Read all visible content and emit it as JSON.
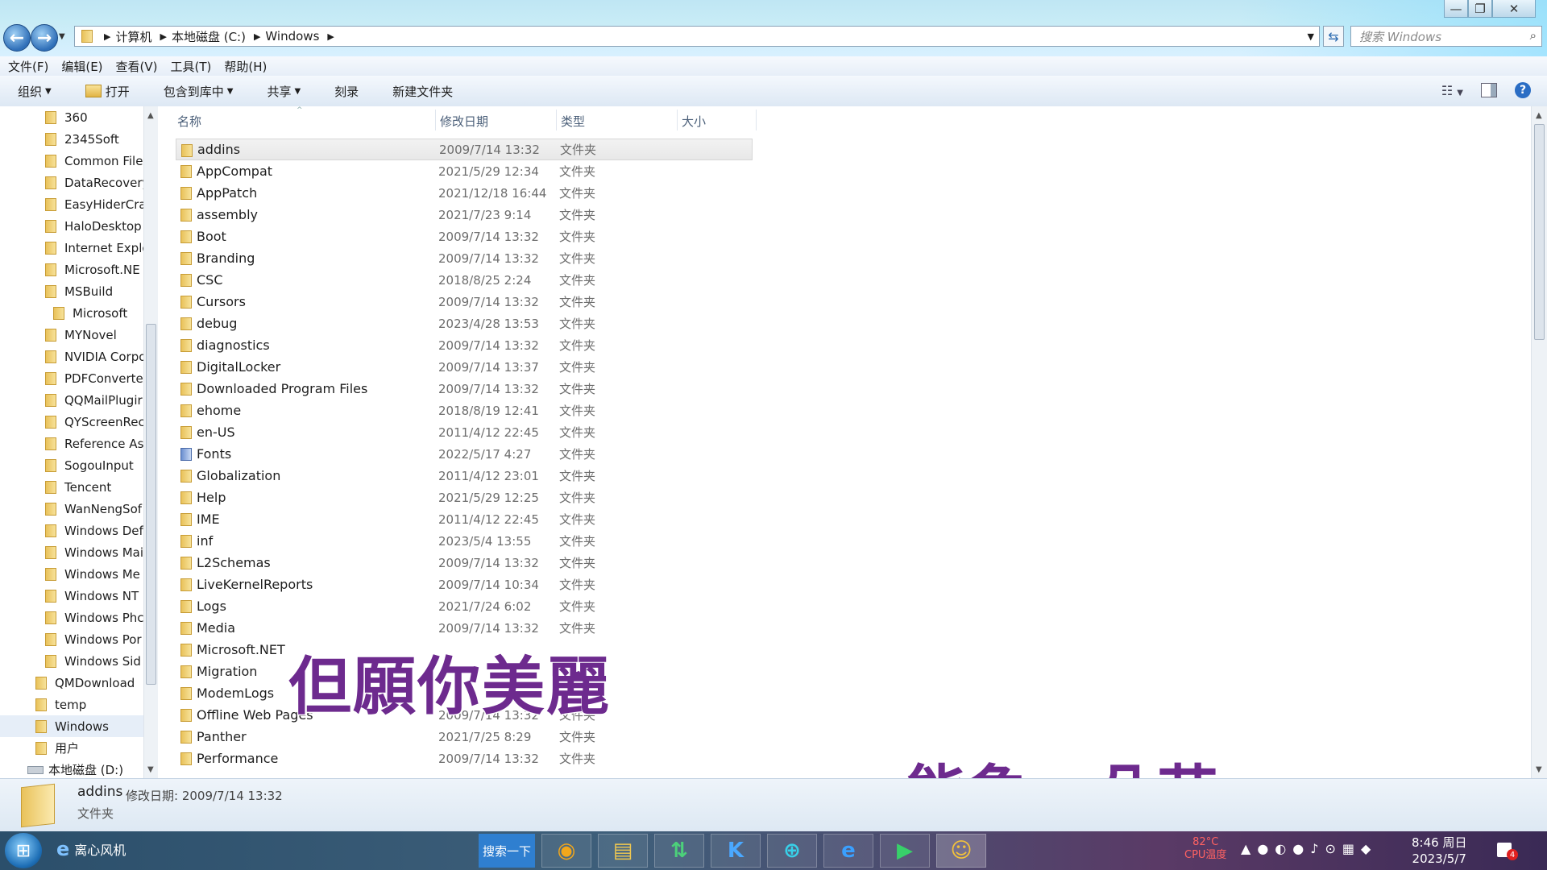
{
  "window": {
    "minimize_glyph": "—",
    "maximize_glyph": "❐",
    "close_glyph": "✕"
  },
  "address": {
    "crumbs": [
      "计算机",
      "本地磁盘 (C:)",
      "Windows"
    ],
    "search_placeholder": "搜索 Windows"
  },
  "menu": [
    "文件(F)",
    "编辑(E)",
    "查看(V)",
    "工具(T)",
    "帮助(H)"
  ],
  "toolbar": {
    "organize": "组织",
    "open": "打开",
    "include_library": "包含到库中",
    "share": "共享",
    "burn": "刻录",
    "new_folder": "新建文件夹"
  },
  "nav_items": [
    "360",
    "2345Soft",
    "Common File",
    "DataRecovery",
    "EasyHiderCra",
    "HaloDesktop",
    "Internet Explo",
    "Microsoft.NE",
    "MSBuild",
    "Microsoft",
    "MYNovel",
    "NVIDIA Corpo",
    "PDFConverte",
    "QQMailPlugir",
    "QYScreenRec",
    "Reference As",
    "SogouInput",
    "Tencent",
    "WanNengSof",
    "Windows Def",
    "Windows Mai",
    "Windows Me",
    "Windows NT",
    "Windows Phc",
    "Windows Por",
    "Windows Sid",
    "QMDownload",
    "temp",
    "Windows",
    "用户",
    "本地磁盘 (D:)"
  ],
  "columns": {
    "name": "名称",
    "modified": "修改日期",
    "type": "类型",
    "size": "大小"
  },
  "files": [
    {
      "name": "addins",
      "date": "2009/7/14 13:32",
      "type": "文件夹"
    },
    {
      "name": "AppCompat",
      "date": "2021/5/29 12:34",
      "type": "文件夹"
    },
    {
      "name": "AppPatch",
      "date": "2021/12/18 16:44",
      "type": "文件夹"
    },
    {
      "name": "assembly",
      "date": "2021/7/23 9:14",
      "type": "文件夹"
    },
    {
      "name": "Boot",
      "date": "2009/7/14 13:32",
      "type": "文件夹"
    },
    {
      "name": "Branding",
      "date": "2009/7/14 13:32",
      "type": "文件夹"
    },
    {
      "name": "CSC",
      "date": "2018/8/25 2:24",
      "type": "文件夹"
    },
    {
      "name": "Cursors",
      "date": "2009/7/14 13:32",
      "type": "文件夹"
    },
    {
      "name": "debug",
      "date": "2023/4/28 13:53",
      "type": "文件夹"
    },
    {
      "name": "diagnostics",
      "date": "2009/7/14 13:32",
      "type": "文件夹"
    },
    {
      "name": "DigitalLocker",
      "date": "2009/7/14 13:37",
      "type": "文件夹"
    },
    {
      "name": "Downloaded Program Files",
      "date": "2009/7/14 13:32",
      "type": "文件夹"
    },
    {
      "name": "ehome",
      "date": "2018/8/19 12:41",
      "type": "文件夹"
    },
    {
      "name": "en-US",
      "date": "2011/4/12 22:45",
      "type": "文件夹"
    },
    {
      "name": "Fonts",
      "date": "2022/5/17 4:27",
      "type": "文件夹"
    },
    {
      "name": "Globalization",
      "date": "2011/4/12 23:01",
      "type": "文件夹"
    },
    {
      "name": "Help",
      "date": "2021/5/29 12:25",
      "type": "文件夹"
    },
    {
      "name": "IME",
      "date": "2011/4/12 22:45",
      "type": "文件夹"
    },
    {
      "name": "inf",
      "date": "2023/5/4 13:55",
      "type": "文件夹"
    },
    {
      "name": "L2Schemas",
      "date": "2009/7/14 13:32",
      "type": "文件夹"
    },
    {
      "name": "LiveKernelReports",
      "date": "2009/7/14 10:34",
      "type": "文件夹"
    },
    {
      "name": "Logs",
      "date": "2021/7/24 6:02",
      "type": "文件夹"
    },
    {
      "name": "Media",
      "date": "2009/7/14 13:32",
      "type": "文件夹"
    },
    {
      "name": "Microsoft.NET",
      "date": "",
      "type": ""
    },
    {
      "name": "Migration",
      "date": "",
      "type": ""
    },
    {
      "name": "ModemLogs",
      "date": "",
      "type": ""
    },
    {
      "name": "Offline Web Pages",
      "date": "2009/7/14 13:32",
      "type": "文件夹"
    },
    {
      "name": "Panther",
      "date": "2021/7/25 8:29",
      "type": "文件夹"
    },
    {
      "name": "Performance",
      "date": "2009/7/14 13:32",
      "type": "文件夹"
    }
  ],
  "captions": {
    "top": "但願你美麗",
    "bottom": "能象一朵花"
  },
  "details": {
    "name": "addins",
    "modified_label": "修改日期: 2009/7/14 13:32",
    "type": "文件夹"
  },
  "taskbar": {
    "ie_title": "离心风机",
    "search_btn": "搜索一下",
    "cpu_temp": "82°C",
    "cpu_label": "CPU温度",
    "time": "8:46 周日",
    "date": "2023/5/7",
    "notif_count": "4"
  },
  "colors": {
    "accent": "#2f7fd0",
    "caption": "#6d2a8e",
    "selection": "#e8e8e8"
  }
}
